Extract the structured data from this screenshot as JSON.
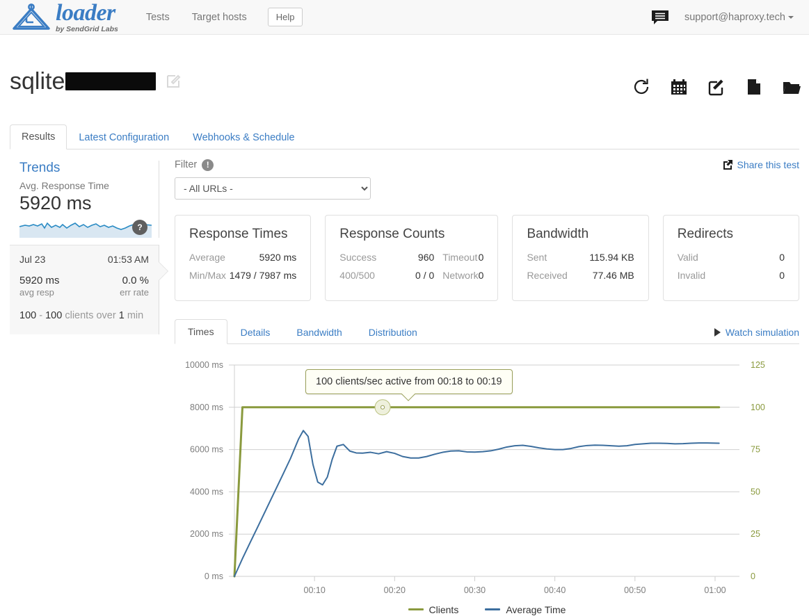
{
  "navbar": {
    "brand_word": "loader",
    "brand_sub": "by SendGrid Labs",
    "links": [
      {
        "label": "Tests"
      },
      {
        "label": "Target hosts"
      }
    ],
    "help_label": "Help",
    "chat_icon": "chat-icon",
    "user_email": "support@haproxy.tech"
  },
  "page": {
    "title_prefix": "sqlite",
    "title_redacted": true,
    "edit_icon": "edit-square-icon"
  },
  "action_bar": {
    "icons": [
      {
        "name": "rerun-icon"
      },
      {
        "name": "calendar-icon"
      },
      {
        "name": "edit-icon"
      },
      {
        "name": "copy-page-icon"
      },
      {
        "name": "folder-icon"
      }
    ]
  },
  "tabs": [
    {
      "label": "Results",
      "active": true
    },
    {
      "label": "Latest Configuration",
      "active": false
    },
    {
      "label": "Webhooks & Schedule",
      "active": false
    }
  ],
  "trends": {
    "title": "Trends",
    "subtitle": "Avg. Response Time",
    "value": "5920 ms",
    "badge": "?",
    "detail": {
      "date": "Jul 23",
      "time": "01:53 AM",
      "avg_resp_value": "5920 ms",
      "avg_resp_label": "avg resp",
      "err_rate_value": "0.0 %",
      "err_rate_label": "err rate",
      "clients_from": "100",
      "clients_dash": "-",
      "clients_to": "100",
      "clients_mid": "clients over",
      "clients_duration": "1",
      "clients_unit": "min"
    }
  },
  "filter": {
    "label": "Filter",
    "info_badge": "!",
    "selected": "- All URLs -",
    "options": [
      "- All URLs -"
    ]
  },
  "share": {
    "label": "Share this test",
    "icon": "share-icon"
  },
  "cards": [
    {
      "title": "Response Times",
      "layout": "two",
      "rows": [
        {
          "k": "Average",
          "v": "5920 ms"
        },
        {
          "k": "Min/Max",
          "v": "1479 / 7987 ms"
        }
      ]
    },
    {
      "title": "Response Counts",
      "layout": "four",
      "rows": [
        {
          "a": "Success",
          "b": "960",
          "c": "Timeout",
          "d": "0"
        },
        {
          "a": "400/500",
          "b": "0 / 0",
          "c": "Network",
          "d": "0"
        }
      ]
    },
    {
      "title": "Bandwidth",
      "layout": "two",
      "rows": [
        {
          "k": "Sent",
          "v": "115.94 KB"
        },
        {
          "k": "Received",
          "v": "77.46 MB"
        }
      ]
    },
    {
      "title": "Redirects",
      "layout": "two",
      "rows": [
        {
          "k": "Valid",
          "v": "0"
        },
        {
          "k": "Invalid",
          "v": "0"
        }
      ]
    }
  ],
  "chart_tabs": [
    {
      "label": "Times",
      "active": true
    },
    {
      "label": "Details",
      "active": false
    },
    {
      "label": "Bandwidth",
      "active": false
    },
    {
      "label": "Distribution",
      "active": false
    }
  ],
  "watch": {
    "label": "Watch simulation",
    "icon": "play-icon"
  },
  "tooltip": {
    "text": "100 clients/sec active from 00:18 to 00:19"
  },
  "chart_data": {
    "type": "line",
    "title": "",
    "xlabel": "",
    "ylabel": "",
    "x_ticks": [
      "00:10",
      "00:20",
      "00:30",
      "00:40",
      "00:50",
      "01:00"
    ],
    "x_tick_seconds": [
      10,
      20,
      30,
      40,
      50,
      60
    ],
    "xlim": [
      0,
      62
    ],
    "left_axis": {
      "label": "ms",
      "ticks": [
        "0 ms",
        "2000 ms",
        "4000 ms",
        "6000 ms",
        "8000 ms",
        "10000 ms"
      ],
      "tick_values": [
        0,
        2000,
        4000,
        6000,
        8000,
        10000
      ],
      "ylim": [
        0,
        10000
      ],
      "color": "#888888"
    },
    "right_axis": {
      "label": "clients",
      "ticks": [
        "0",
        "25",
        "50",
        "75",
        "100",
        "125"
      ],
      "tick_values": [
        0,
        25,
        50,
        75,
        100,
        125
      ],
      "ylim": [
        0,
        125
      ],
      "color": "#8a9a3e"
    },
    "grid": true,
    "legend_position": "bottom",
    "series": [
      {
        "name": "Clients",
        "axis": "right",
        "color": "#8a9a3e",
        "x": [
          0,
          1,
          2,
          60.5
        ],
        "values": [
          0,
          100,
          100,
          100
        ]
      },
      {
        "name": "Average Time",
        "axis": "left",
        "color": "#3c6e9e",
        "x": [
          0,
          1,
          2,
          3,
          4,
          5,
          6,
          7,
          8,
          8.6,
          9.2,
          9.8,
          10.4,
          11,
          11.6,
          12.2,
          12.8,
          13.6,
          14.4,
          15.2,
          16,
          17,
          18,
          19,
          20,
          21,
          22,
          23,
          24,
          25,
          26,
          27,
          28,
          29,
          30,
          31,
          32,
          33,
          34,
          35,
          36,
          37,
          38,
          39,
          40,
          41,
          42,
          43,
          44,
          45,
          46,
          47,
          48,
          49,
          50,
          51,
          52,
          53,
          54,
          55,
          56,
          57,
          58,
          59,
          60.5
        ],
        "values": [
          0,
          840,
          1630,
          2410,
          3200,
          3990,
          4780,
          5580,
          6490,
          6900,
          6620,
          5300,
          4460,
          4330,
          4700,
          5530,
          6160,
          6240,
          5930,
          5840,
          5830,
          5870,
          5800,
          5900,
          5820,
          5670,
          5600,
          5600,
          5670,
          5780,
          5870,
          5930,
          5940,
          5890,
          5880,
          5900,
          5940,
          6020,
          6120,
          6180,
          6200,
          6150,
          6080,
          6030,
          6000,
          6000,
          6050,
          6140,
          6190,
          6210,
          6200,
          6180,
          6160,
          6180,
          6240,
          6270,
          6300,
          6300,
          6290,
          6270,
          6280,
          6300,
          6310,
          6310,
          6300
        ]
      }
    ],
    "annotation": {
      "text": "100 clients/sec active from 00:18 to 00:19",
      "x": 18.5,
      "y": 100
    }
  },
  "legend": [
    {
      "label": "Clients",
      "color": "#8a9a3e"
    },
    {
      "label": "Average Time",
      "color": "#3c6e9e"
    }
  ]
}
